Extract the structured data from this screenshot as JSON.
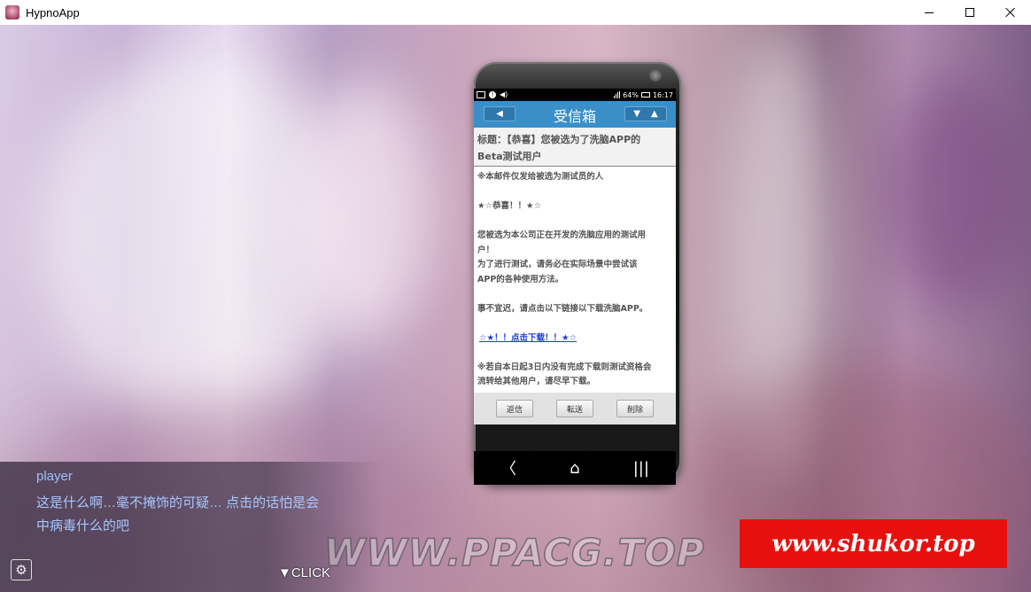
{
  "window": {
    "title": "HypnoApp"
  },
  "phone": {
    "status": {
      "battery": "64%",
      "time": "16:17"
    },
    "mail": {
      "header_title": "受信箱",
      "back_arrow": "◀",
      "down_arrow": "▼",
      "up_arrow": "▲",
      "subject_line1": "标题：【恭喜】您被选为了洗脑APP的",
      "subject_line2": "Beta测试用户",
      "body": [
        "※本邮件仅发给被选为测试员的人",
        "",
        "★☆恭喜！！★☆",
        "",
        "您被选为本公司正在开发的洗脑应用的测试用",
        "户！",
        "为了进行测试，请务必在实际场景中尝试该",
        "APP的各种使用方法。",
        "",
        "事不宜迟，请点击以下链接以下载洗脑APP。",
        ""
      ],
      "link": "☆★！！点击下载！！★☆",
      "footer_body": [
        "",
        "※若自本日起3日内没有完成下载则测试资格会",
        "流转给其他用户，请尽早下载。"
      ],
      "reply_button": "返信",
      "forward_button": "転送",
      "delete_button": "削除"
    },
    "navbar": {
      "back": "〈",
      "home": "⌂",
      "recent": "|||"
    }
  },
  "dialog": {
    "speaker": "player",
    "text_line1": "这是什么啊…毫不掩饰的可疑… 点击的话怕是会",
    "text_line2": "中病毒什么的吧",
    "click_label": "▼CLICK",
    "settings_icon_glyph": "⚙"
  },
  "watermarks": {
    "site_text": "WWW.PPACG.TOP",
    "red_banner": "www.shukor.top"
  }
}
